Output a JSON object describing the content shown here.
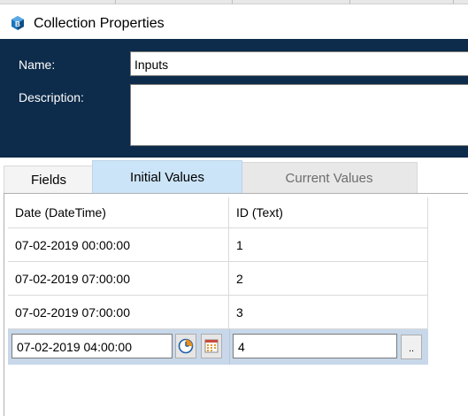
{
  "window": {
    "title": "Collection Properties",
    "icon": "blueprism-cube-icon"
  },
  "properties": {
    "name_label": "Name:",
    "name_value": "Inputs",
    "description_label": "Description:",
    "description_value": ""
  },
  "tabs": [
    {
      "label": "Fields",
      "state": "inactive"
    },
    {
      "label": "Initial Values",
      "state": "active"
    },
    {
      "label": "Current Values",
      "state": "disabled"
    }
  ],
  "grid": {
    "columns": [
      "Date  (DateTime)",
      "ID  (Text)"
    ],
    "rows": [
      [
        "07-02-2019 00:00:00",
        "1"
      ],
      [
        "07-02-2019 07:00:00",
        "2"
      ],
      [
        "07-02-2019 07:00:00",
        "3"
      ]
    ],
    "edit_row": {
      "date_value": "07-02-2019 04:00:00",
      "id_value": "4",
      "ellipsis_label": ".."
    }
  },
  "colors": {
    "header_bg": "#0d2b4a",
    "active_tab": "#cce4f7",
    "edit_row_bg": "#c8d8ea"
  }
}
